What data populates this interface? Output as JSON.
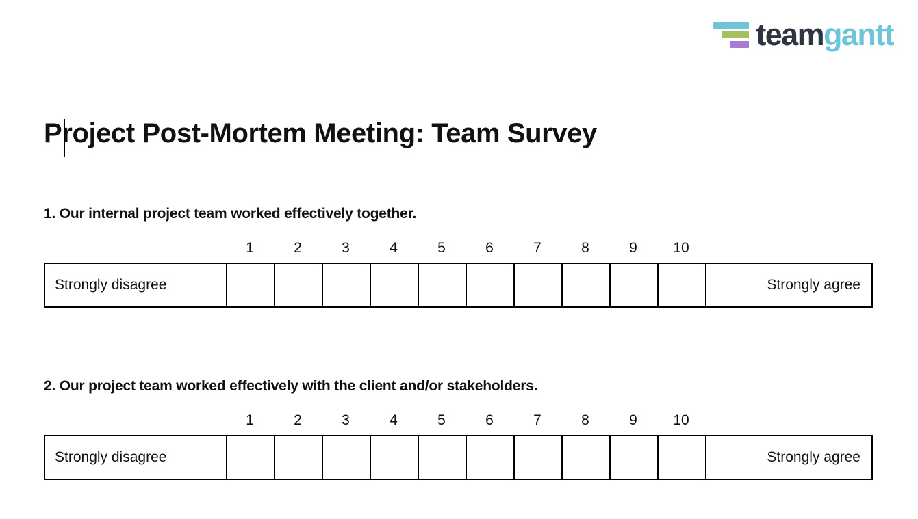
{
  "brand": {
    "name_part_1": "team",
    "name_part_2": "gantt",
    "colors": {
      "bar_top": "#6ec4d9",
      "bar_middle": "#a6c05c",
      "bar_bottom": "#a77bd0",
      "word_dark": "#2e3440",
      "word_light": "#6ec4d9"
    }
  },
  "document": {
    "title": "Project Post-Mortem Meeting: Team Survey",
    "caret_visible": true
  },
  "scale": {
    "numbers": [
      "1",
      "2",
      "3",
      "4",
      "5",
      "6",
      "7",
      "8",
      "9",
      "10"
    ],
    "low_label": "Strongly disagree",
    "high_label": "Strongly agree"
  },
  "questions": [
    {
      "number": "1.",
      "text": "1. Our internal project team worked effectively together."
    },
    {
      "number": "2.",
      "text": "2. Our project team worked effectively with the client and/or stakeholders."
    }
  ]
}
